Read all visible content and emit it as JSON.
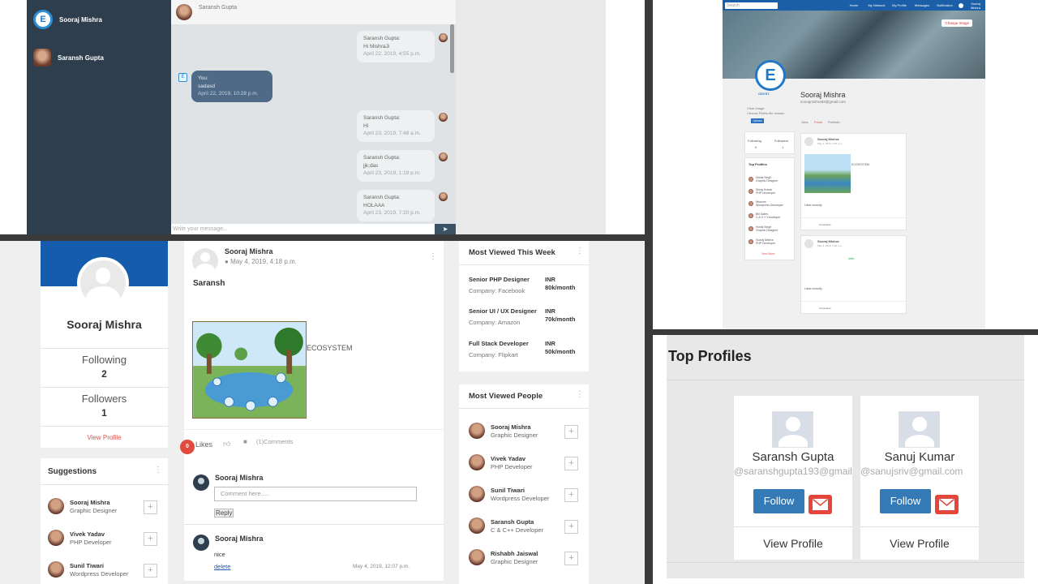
{
  "chat": {
    "contacts": [
      {
        "name": "Sooraj Mishra"
      },
      {
        "name": "Saransh Gupta"
      }
    ],
    "header_name": "Saransh Gupta",
    "messages": [
      {
        "from": "Saransh Gupta:",
        "text": "Hi MishraJi",
        "time": "April 22, 2019, 4:55 p.m."
      },
      {
        "from": "You:",
        "text": "sadasd",
        "time": "April 22, 2019, 10:28 p.m."
      },
      {
        "from": "Saransh Gupta:",
        "text": "HI",
        "time": "April 23, 2019, 7:48 a.m."
      },
      {
        "from": "Saransh Gupta:",
        "text": "jjk;das",
        "time": "April 23, 2019, 1:18 p.m."
      },
      {
        "from": "Saransh Gupta:",
        "text": "HOLAAA",
        "time": "April 23, 2019, 7:20 p.m."
      }
    ],
    "input_placeholder": "Write your message...",
    "send_icon": "send-icon"
  },
  "profile_page": {
    "search_placeholder": "Search",
    "nav_items": [
      "Home",
      "My Network",
      "My Profile",
      "Messages",
      "Notification"
    ],
    "user_menu": "Sooraj Mishra",
    "change_image": "Change Image",
    "name": "Sooraj Mishra",
    "email": "soorajmishra93@gmail.com",
    "logo_text": "OSYST",
    "clear_image": "Clear image",
    "choose_file": "Choose File",
    "no_file": "No file chosen",
    "upload": "Upload",
    "tabs": [
      "Jobs",
      "Posts",
      "Portfolio"
    ],
    "following_label": "Following",
    "following_count": "0",
    "followers_label": "Followers",
    "followers_count": "1",
    "top_profiles_title": "Top Profiles",
    "top_profiles": [
      {
        "name": "Hortal Singh",
        "role": "Graphic Designer"
      },
      {
        "name": "Shray Kumar",
        "role": "PHP Developer"
      },
      {
        "name": "Nisavan",
        "role": "Wordpress Developer"
      },
      {
        "name": "Bill Gates",
        "role": "C & C++ Developer"
      },
      {
        "name": "Hortal Singh",
        "role": "Graphic Designer"
      },
      {
        "name": "Sooraj Mishra",
        "role": "PHP Developer"
      }
    ],
    "view_more": "View More",
    "post1_author": "Sooraj Mishra",
    "post1_date": "May 4, 2019, 4:18 p.m.",
    "post1_caption": "ECOSYSTEM",
    "post1_text": "Liked recently",
    "post2_author": "Sooraj Mishra",
    "post2_date": "May 4, 2019, 4:18 p.m.",
    "post2_text": "hello",
    "post2_footer": "Liked recently",
    "comments_label": "Comments"
  },
  "feed": {
    "profile_name": "Sooraj Mishra",
    "following_label": "Following",
    "following_count": "2",
    "followers_label": "Followers",
    "followers_count": "1",
    "view_profile": "View Profile",
    "suggestions_title": "Suggestions",
    "suggestions": [
      {
        "name": "Sooraj Mishra",
        "role": "Graphic Designer"
      },
      {
        "name": "Vivek Yadav",
        "role": "PHP Developer"
      },
      {
        "name": "Sunil Tiwari",
        "role": "Wordpress Developer"
      }
    ],
    "post": {
      "author": "Sooraj Mishra",
      "date": "May 4, 2019, 4:18 p.m.",
      "title": "Saransh",
      "image_caption": "ECOSYSTEM",
      "like_count": "0",
      "likes_label": "Likes",
      "comments_label": "(1)Comments",
      "comment_author": "Sooraj Mishra",
      "comment_placeholder": "Comment here.....",
      "reply_label": "Reply",
      "existing_comment": {
        "author": "Sooraj Mishra",
        "text": "nice",
        "delete_label": "delete",
        "date": "May 4, 2019, 12:07 p.m."
      }
    },
    "most_viewed_week_title": "Most Viewed This Week",
    "jobs": [
      {
        "title": "Senior PHP Designer",
        "company": "Company: Facebook",
        "pay_currency": "INR",
        "pay": "80k/month"
      },
      {
        "title": "Senior UI / UX Designer",
        "company": "Company: Amazon",
        "pay_currency": "INR",
        "pay": "70k/month"
      },
      {
        "title": "Full Stack Developer",
        "company": "Company: Flipkart",
        "pay_currency": "INR",
        "pay": "50k/month"
      }
    ],
    "most_viewed_people_title": "Most Viewed People",
    "people": [
      {
        "name": "Sooraj Mishra",
        "role": "Graphic Designer"
      },
      {
        "name": "Vivek Yadav",
        "role": "PHP Developer"
      },
      {
        "name": "Sunil Tiwari",
        "role": "Wordpress Developer"
      },
      {
        "name": "Saransh Gupta",
        "role": "C & C++ Developer"
      },
      {
        "name": "Rishabh Jaiswal",
        "role": "Graphic Designer"
      }
    ]
  },
  "top_profiles": {
    "title": "Top Profiles",
    "cards": [
      {
        "name": "Saransh Gupta",
        "email": "@saranshgupta193@gmail.com",
        "follow": "Follow",
        "view": "View Profile"
      },
      {
        "name": "Sanuj Kumar",
        "email": "@sanujsriv@gmail.com",
        "follow": "Follow",
        "view": "View Profile"
      }
    ]
  },
  "colors": {
    "primary": "#155cad",
    "chat_sidebar": "#2f3e4c",
    "follow_button": "#337ab7",
    "mail_button": "#e4463b",
    "link_red": "#d9534f"
  }
}
